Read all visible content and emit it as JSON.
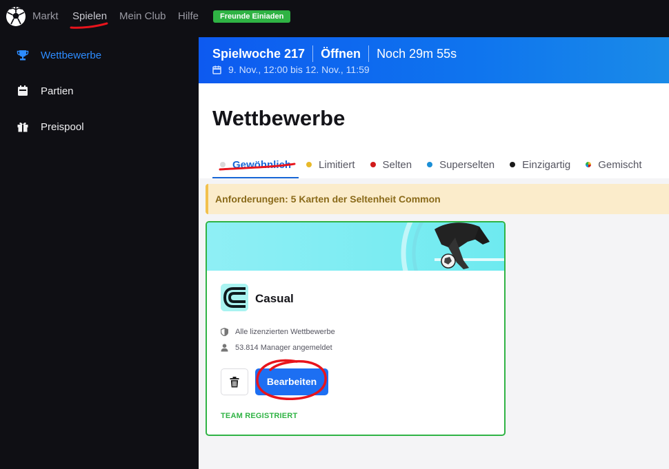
{
  "topnav": {
    "links": [
      "Markt",
      "Spielen",
      "Mein Club",
      "Hilfe"
    ],
    "invite_label": "Freunde Einiaden",
    "invite_color": "#2fb344"
  },
  "sidebar": {
    "items": [
      {
        "label": "Wettbewerbe",
        "icon": "trophy-icon",
        "active": true
      },
      {
        "label": "Partien",
        "icon": "calendar-icon",
        "active": false
      },
      {
        "label": "Preispool",
        "icon": "gift-icon",
        "active": false
      }
    ]
  },
  "banner": {
    "week": "Spielwoche 217",
    "status": "Öffnen",
    "countdown": "Noch 29m 55s",
    "dates": "9. Nov., 12:00 bis 12. Nov., 11:59"
  },
  "page": {
    "title": "Wettbewerbe"
  },
  "tabs": [
    {
      "label": "Gewöhnlich",
      "dot": "#d9d9d9",
      "active": true
    },
    {
      "label": "Limitiert",
      "dot": "#e8b92a",
      "active": false
    },
    {
      "label": "Selten",
      "dot": "#d11a1a",
      "active": false
    },
    {
      "label": "Superselten",
      "dot": "#1b8fd6",
      "active": false
    },
    {
      "label": "Einzigartig",
      "dot": "#1a1a1a",
      "active": false
    },
    {
      "label": "Gemischt",
      "dot": "multicolor",
      "active": false
    }
  ],
  "requirements": "Anforderungen: 5 Karten der Seltenheit Common",
  "card": {
    "title": "Casual",
    "competitions": "Alle lizenzierten Wettbewerbe",
    "managers": "53.814 Manager angemeldet",
    "edit_label": "Bearbeiten",
    "status": "TEAM REGISTRIERT"
  },
  "colors": {
    "accent": "#1d6ff2",
    "active_nav": "#2d8cff",
    "success": "#2fb344",
    "annotation": "#e8141c"
  }
}
